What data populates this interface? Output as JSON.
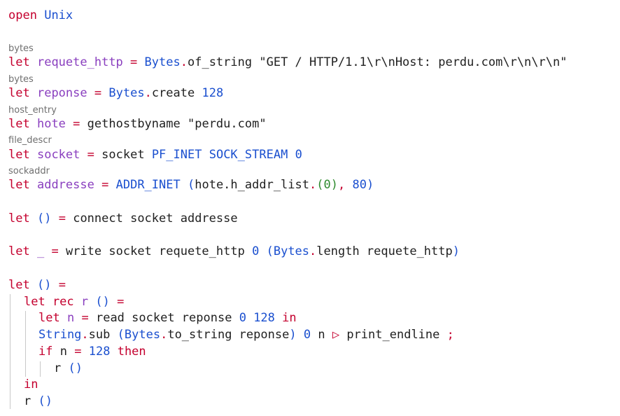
{
  "code": {
    "l1": {
      "kw": "open",
      "mod": "Unix"
    },
    "hint1": "bytes",
    "l2": {
      "kw": "let",
      "name": "requete_http",
      "eq": "=",
      "mod": "Bytes",
      "dot": ".",
      "fn": "of_string",
      "str": "\"GET / HTTP/1.1\\r\\nHost: perdu.com\\r\\n\\r\\n\""
    },
    "hint2": "bytes",
    "l3": {
      "kw": "let",
      "name": "reponse",
      "eq": "=",
      "mod": "Bytes",
      "dot": ".",
      "fn": "create",
      "num": "128"
    },
    "hint3": "host_entry",
    "l4": {
      "kw": "let",
      "name": "hote",
      "eq": "=",
      "fn": "gethostbyname",
      "str": "\"perdu.com\""
    },
    "hint4": "file_descr",
    "l5": {
      "kw": "let",
      "name": "socket",
      "eq": "=",
      "fn": "socket",
      "c1": "PF_INET",
      "c2": "SOCK_STREAM",
      "num": "0"
    },
    "hint5": "sockaddr",
    "l6": {
      "kw": "let",
      "name": "addresse",
      "eq": "=",
      "ctor": "ADDR_INET",
      "po": "(",
      "field": "hote.h_addr_list",
      "dot": ".",
      "ai": "(0)",
      "comma": ",",
      "num": "80",
      "pc": ")"
    },
    "l7": {
      "kw": "let",
      "unit": "()",
      "eq": "=",
      "rest": "connect socket addresse"
    },
    "l8": {
      "kw": "let",
      "name": "_",
      "eq": "=",
      "rest": "write socket requete_http",
      "num": "0",
      "po": "(",
      "mod": "Bytes",
      "dot": ".",
      "fn": "length requete_http",
      "pc": ")"
    },
    "l9": {
      "kw": "let",
      "unit": "()",
      "eq": "="
    },
    "l10": {
      "kw": "let rec",
      "name": "r",
      "unit": "()",
      "eq": "="
    },
    "l11": {
      "kw": "let",
      "name": "n",
      "eq": "=",
      "rest": "read socket reponse",
      "n1": "0",
      "n2": "128",
      "kw2": "in"
    },
    "l12": {
      "mod": "String",
      "dot": ".",
      "fn": "sub",
      "po": "(",
      "mod2": "Bytes",
      "dot2": ".",
      "fn2": "to_string reponse",
      "pc": ")",
      "n1": "0",
      "v": "n",
      "pipe": "▷",
      "fn3": "print_endline",
      "semi": ";"
    },
    "l13": {
      "kw": "if",
      "v": "n",
      "eq": "=",
      "num": "128",
      "kw2": "then"
    },
    "l14": {
      "fn": "r",
      "unit": "()"
    },
    "l15": {
      "kw": "in"
    },
    "l16": {
      "fn": "r",
      "unit": "()"
    }
  }
}
